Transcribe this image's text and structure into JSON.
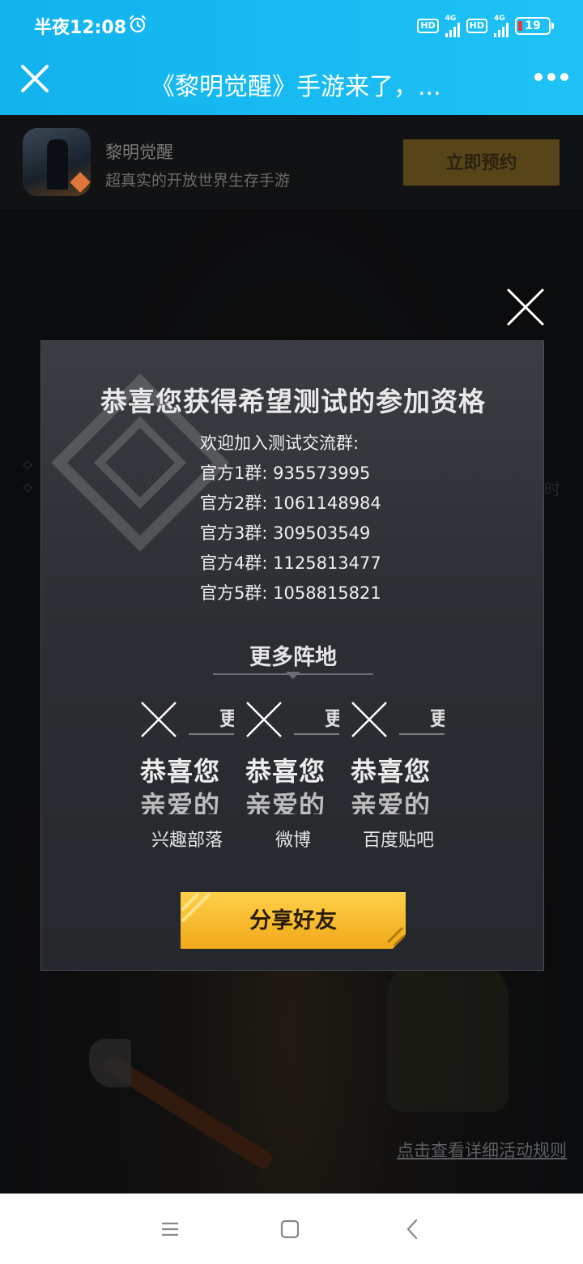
{
  "status_bar": {
    "time": "半夜12:08",
    "network1": "4G",
    "network2": "4G",
    "hd_label": "HD",
    "battery": "19"
  },
  "title_bar": {
    "title": "《黎明觉醒》手游来了，..."
  },
  "app_banner": {
    "name": "黎明觉醒",
    "description": "超真实的开放世界生存手游",
    "reserve_label": "立即预约"
  },
  "background": {
    "partial_text": "时",
    "rules_link": "点击查看详细活动规则"
  },
  "modal": {
    "title": "恭喜您获得希望测试的参加资格",
    "welcome": "欢迎加入测试交流群:",
    "groups": [
      {
        "label": "官方1群:",
        "number": "935573995"
      },
      {
        "label": "官方2群:",
        "number": "1061148984"
      },
      {
        "label": "官方3群:",
        "number": "309503549"
      },
      {
        "label": "官方4群:",
        "number": "1125813477"
      },
      {
        "label": "官方5群:",
        "number": "1058815821"
      }
    ],
    "more_title": "更多阵地",
    "tiles": [
      {
        "label": "兴趣部落",
        "frag_char": "更",
        "frag_line1": "恭喜您",
        "frag_line2": "亲爱的"
      },
      {
        "label": "微博",
        "frag_char": "更",
        "frag_line1": "恭喜您",
        "frag_line2": "亲爱的"
      },
      {
        "label": "百度贴吧",
        "frag_char": "更",
        "frag_line1": "恭喜您",
        "frag_line2": "亲爱的"
      }
    ],
    "share_label": "分享好友"
  },
  "icons": [
    "alarm-icon",
    "close-icon",
    "more-icon",
    "home-icon",
    "menu-icon",
    "back-icon"
  ],
  "colors": {
    "header_blue": "#1ab8f0",
    "button_gold": "#f5b722",
    "modal_bg": "#2e3135"
  }
}
